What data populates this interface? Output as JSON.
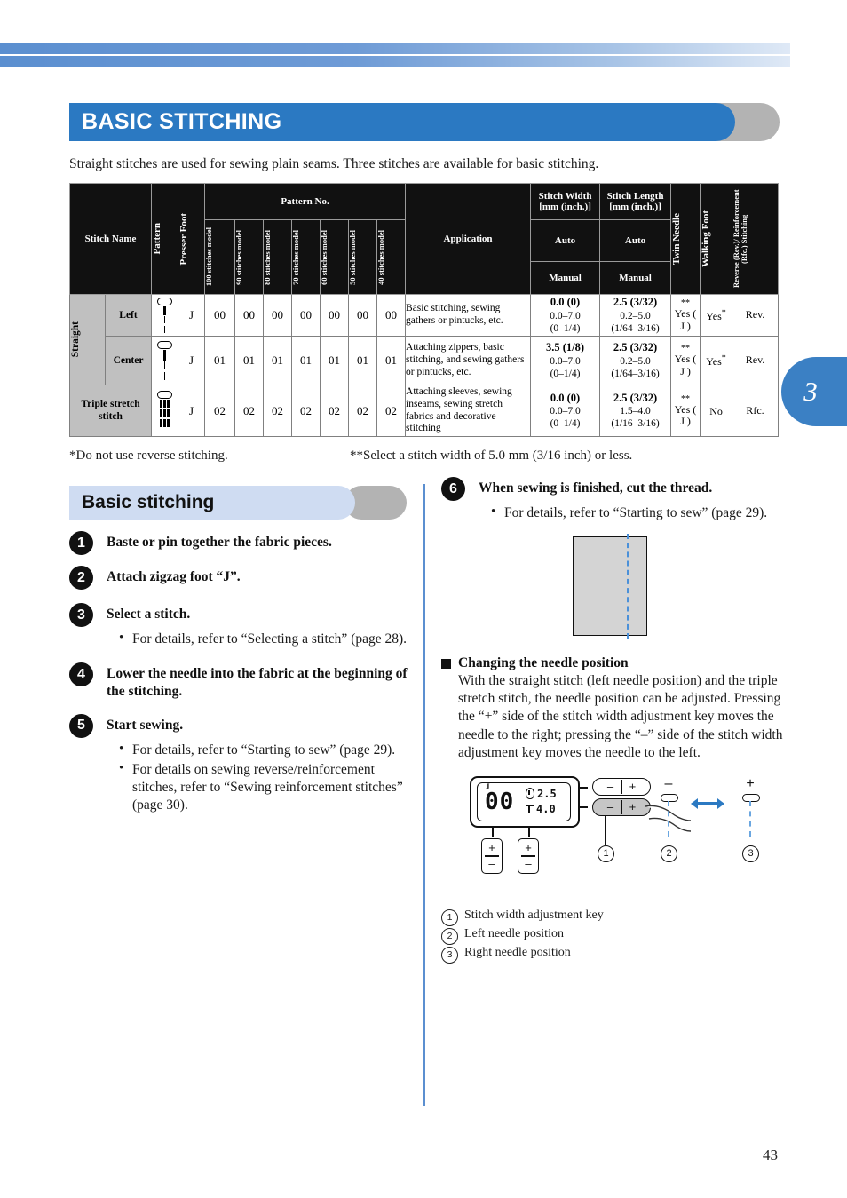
{
  "chapter_tab": "3",
  "page_number": "43",
  "header": {
    "title": "BASIC STITCHING",
    "intro": "Straight stitches are used for sewing plain seams. Three stitches are available for basic stitching."
  },
  "table": {
    "headers": {
      "stitch_name": "Stitch Name",
      "pattern": "Pattern",
      "presser_foot": "Presser Foot",
      "pattern_no": "Pattern No.",
      "models": [
        "100 stitches model",
        "90 stitches model",
        "80 stitches model",
        "70 stitches model",
        "60 stitches model",
        "50 stitches model",
        "40 stitches model"
      ],
      "application": "Application",
      "stitch_width": "Stitch Width [mm (inch.)]",
      "stitch_length": "Stitch Length [mm (inch.)]",
      "auto": "Auto",
      "manual": "Manual",
      "twin_needle": "Twin Needle",
      "walking_foot": "Walking Foot",
      "reverse": "Reverse (Rev.)/ Reinforcement (Rfc.) Stitching"
    },
    "group_label": "Straight",
    "rows": [
      {
        "sub_name": "Left",
        "glyph": "straight-left-stitch-icon",
        "presser_foot": "J",
        "pattern_nos": [
          "00",
          "00",
          "00",
          "00",
          "00",
          "00",
          "00"
        ],
        "application": "Basic stitching, sewing gathers or pintucks, etc.",
        "width_auto": "0.0 (0)",
        "width_manual_mm": "0.0–7.0",
        "width_manual_in": "(0–1/4)",
        "length_auto": "2.5 (3/32)",
        "length_manual_mm": "0.2–5.0",
        "length_manual_in": "(1/64–3/16)",
        "twin_needle": "Yes ( J )",
        "twin_needle_mark": "**",
        "walking_foot": "Yes",
        "walking_foot_mark": "*",
        "reverse": "Rev."
      },
      {
        "sub_name": "Center",
        "glyph": "straight-center-stitch-icon",
        "presser_foot": "J",
        "pattern_nos": [
          "01",
          "01",
          "01",
          "01",
          "01",
          "01",
          "01"
        ],
        "application": "Attaching zippers, basic stitching, and sewing gathers or pintucks, etc.",
        "width_auto": "3.5 (1/8)",
        "width_manual_mm": "0.0–7.0",
        "width_manual_in": "(0–1/4)",
        "length_auto": "2.5 (3/32)",
        "length_manual_mm": "0.2–5.0",
        "length_manual_in": "(1/64–3/16)",
        "twin_needle": "Yes ( J )",
        "twin_needle_mark": "**",
        "walking_foot": "Yes",
        "walking_foot_mark": "*",
        "reverse": "Rev."
      },
      {
        "sub_name": "Triple stretch stitch",
        "glyph": "triple-stretch-stitch-icon",
        "presser_foot": "J",
        "pattern_nos": [
          "02",
          "02",
          "02",
          "02",
          "02",
          "02",
          "02"
        ],
        "application": "Attaching sleeves, sewing inseams, sewing stretch fabrics and decorative stitching",
        "width_auto": "0.0 (0)",
        "width_manual_mm": "0.0–7.0",
        "width_manual_in": "(0–1/4)",
        "length_auto": "2.5 (3/32)",
        "length_manual_mm": "1.5–4.0",
        "length_manual_in": "(1/16–3/16)",
        "twin_needle": "Yes ( J )",
        "twin_needle_mark": "**",
        "walking_foot": "No",
        "walking_foot_mark": "",
        "reverse": "Rfc."
      }
    ]
  },
  "footnotes": {
    "single_star": "*Do not use reverse stitching.",
    "double_star": "**Select a stitch width of 5.0 mm (3/16 inch) or less."
  },
  "section": {
    "heading": "Basic stitching"
  },
  "steps_left": [
    {
      "num": "1",
      "title": "Baste or pin together the fabric pieces.",
      "bullets": []
    },
    {
      "num": "2",
      "title": "Attach zigzag foot “J”.",
      "bullets": []
    },
    {
      "num": "3",
      "title": "Select a stitch.",
      "bullets": [
        "For details, refer to “Selecting a stitch” (page 28)."
      ]
    },
    {
      "num": "4",
      "title": "Lower the needle into the fabric at the beginning of the stitching.",
      "bullets": []
    },
    {
      "num": "5",
      "title": "Start sewing.",
      "bullets": [
        "For details, refer to “Starting to sew” (page 29).",
        "For details on sewing reverse/reinforcement stitches, refer to “Sewing reinforcement stitches” (page 30)."
      ]
    }
  ],
  "steps_right": [
    {
      "num": "6",
      "title": "When sewing is finished, cut the thread.",
      "bullets": [
        "For details, refer to “Starting to sew” (page 29)."
      ]
    }
  ],
  "subsection": {
    "heading": "Changing the needle position",
    "body": "With the straight stitch (left needle position) and the triple stretch stitch, the needle position can be adjusted. Pressing the “+” side of the stitch width adjustment key moves the needle to the right; pressing the “–” side of the stitch width adjustment key moves the needle to the left."
  },
  "diagram": {
    "lcd": {
      "foot_letter": "J",
      "pattern_number": "00",
      "stitch_width_value": "2.5",
      "stitch_length_value": "4.0"
    },
    "key_minus": "–",
    "key_plus": "+",
    "needle_left_sign": "–",
    "needle_right_sign": "+",
    "callouts": [
      "1",
      "2",
      "3"
    ]
  },
  "legend": [
    {
      "num": "1",
      "text": "Stitch width adjustment key"
    },
    {
      "num": "2",
      "text": "Left needle position"
    },
    {
      "num": "3",
      "text": "Right needle position"
    }
  ],
  "colors": {
    "brand_blue": "#2b79c2",
    "light_blue": "#cfdcf2",
    "seam_blue": "#4a90d9",
    "header_black": "#111111",
    "cat_gray": "#c0c0c0"
  }
}
